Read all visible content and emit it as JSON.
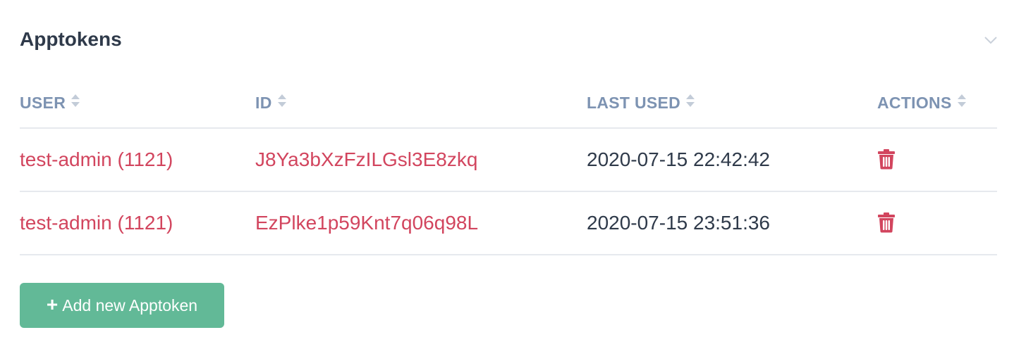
{
  "panel": {
    "title": "Apptokens",
    "collapse_icon": "chevron-down-icon"
  },
  "table": {
    "columns": [
      {
        "label": "USER",
        "sort_icon": "sort-icon"
      },
      {
        "label": "ID",
        "sort_icon": "sort-icon"
      },
      {
        "label": "LAST USED",
        "sort_icon": "sort-icon"
      },
      {
        "label": "ACTIONS",
        "sort_icon": "sort-icon"
      }
    ],
    "rows": [
      {
        "user": "test-admin (1121)",
        "id": "J8Ya3bXzFzILGsl3E8zkq",
        "last_used": "2020-07-15 22:42:42",
        "action_icon": "trash-icon"
      },
      {
        "user": "test-admin (1121)",
        "id": "EzPlke1p59Knt7q06q98L",
        "last_used": "2020-07-15 23:51:36",
        "action_icon": "trash-icon"
      }
    ]
  },
  "add_button": {
    "icon": "plus-icon",
    "plus_glyph": "+",
    "label": "Add new Apptoken"
  },
  "colors": {
    "title": "#2f3a4a",
    "header": "#7d93b2",
    "link": "#d2455e",
    "divider": "#e6e9ee",
    "button": "#62b997"
  }
}
